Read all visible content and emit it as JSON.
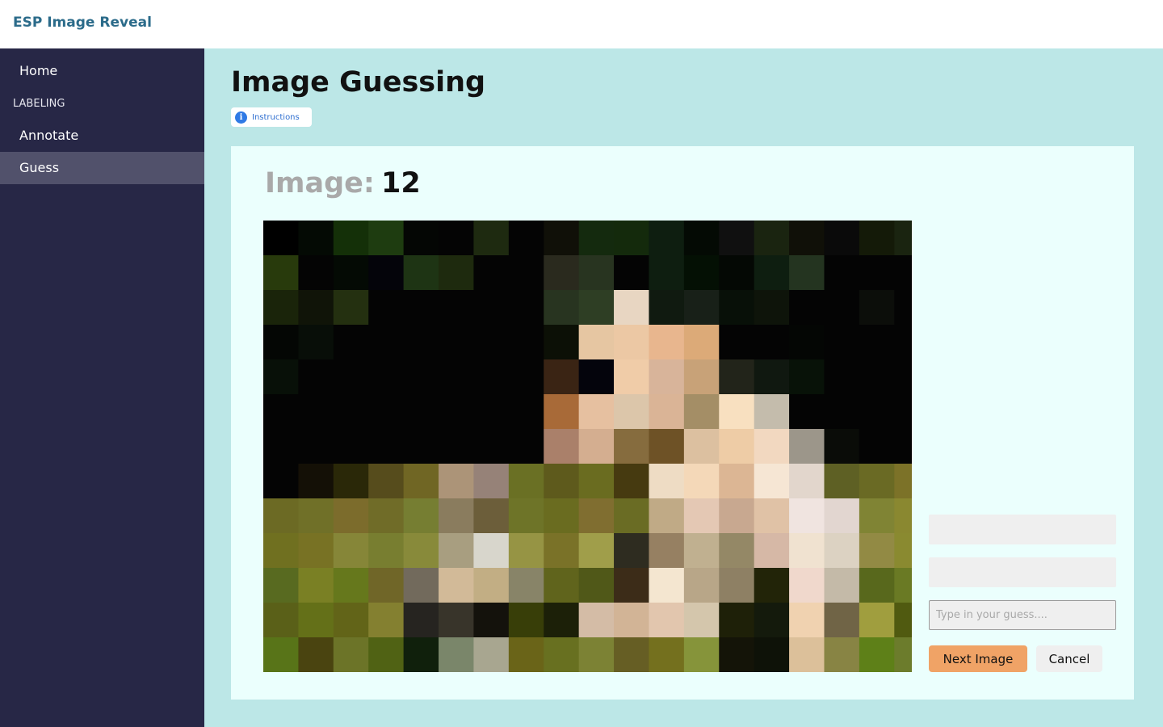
{
  "app": {
    "title": "ESP Image Reveal"
  },
  "sidebar": {
    "home": "Home",
    "section": "LABELING",
    "items": [
      {
        "label": "Annotate",
        "active": false
      },
      {
        "label": "Guess",
        "active": true
      }
    ]
  },
  "page": {
    "title": "Image Guessing",
    "instructions_label": "Instructions",
    "image_label": "Image:",
    "image_number": "12"
  },
  "guess": {
    "placeholder": "Type in your guess....",
    "value": ""
  },
  "buttons": {
    "next": "Next Image",
    "cancel": "Cancel"
  },
  "colors": {
    "sidebar_bg": "#272746",
    "sidebar_active": "#51516b",
    "main_bg": "#bce7e7",
    "card_bg": "#ebfffd",
    "brand": "#2b6b8a",
    "next_button": "#f0a366"
  },
  "icons": {
    "instructions": "info-icon"
  }
}
